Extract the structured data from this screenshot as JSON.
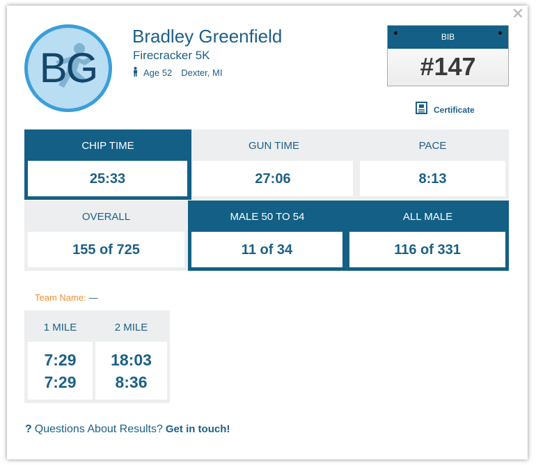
{
  "close_label": "×",
  "participant": {
    "initials": "BG",
    "name": "Bradley Greenfield",
    "event": "Firecracker 5K",
    "age": "Age 52",
    "location": "Dexter, MI"
  },
  "bib": {
    "label": "BIB",
    "number": "#147"
  },
  "certificate": {
    "label": "Certificate",
    "icon": "certificate-icon"
  },
  "stats": [
    {
      "label": "CHIP TIME",
      "value": "25:33"
    },
    {
      "label": "GUN TIME",
      "value": "27:06"
    },
    {
      "label": "PACE",
      "value": "8:13"
    },
    {
      "label": "OVERALL",
      "value": "155 of 725"
    },
    {
      "label": "MALE 50 TO 54",
      "value": "11 of 34"
    },
    {
      "label": "ALL MALE",
      "value": "116 of 331"
    }
  ],
  "team": {
    "label": "Team Name:",
    "value": "—"
  },
  "splits": [
    {
      "label": "1 MILE",
      "time": "7:29",
      "split": "7:29"
    },
    {
      "label": "2 MILE",
      "time": "18:03",
      "split": "8:36"
    }
  ],
  "questions": {
    "mark": "?",
    "text": "Questions About Results?",
    "link": "Get in touch!"
  },
  "colors": {
    "primary": "#135f85",
    "text": "#1c5f86",
    "light_bg": "#eceeef",
    "accent": "#ee8f2f",
    "avatar_bg": "#b9ddf3",
    "avatar_border": "#3b9ed9"
  }
}
